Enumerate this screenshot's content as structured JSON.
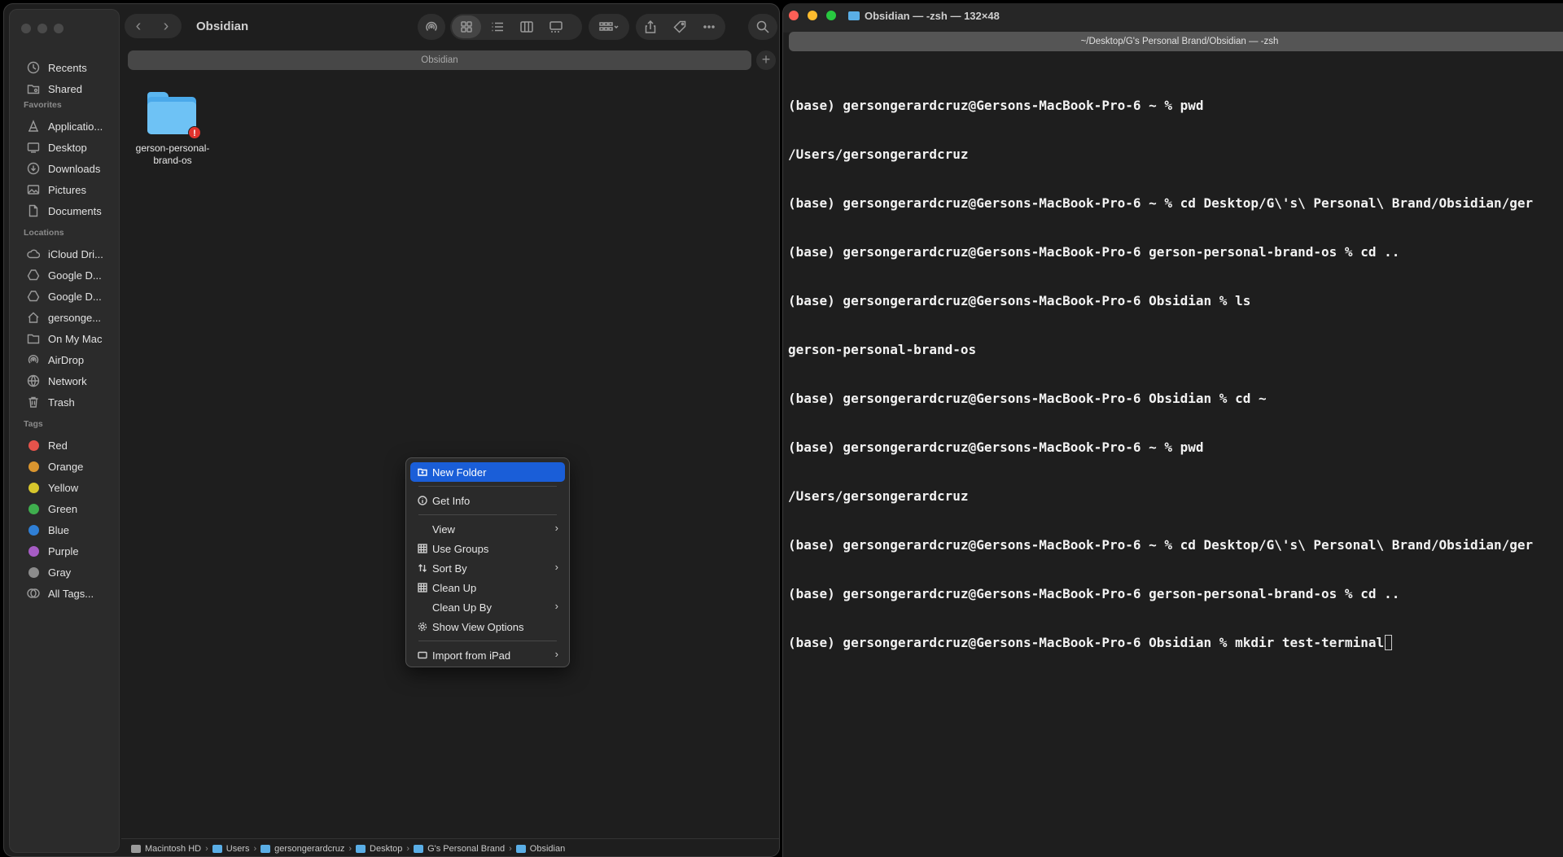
{
  "finder": {
    "window_title": "Obsidian",
    "tab_label": "Obsidian",
    "sidebar": {
      "top_items": [
        {
          "label": "Recents",
          "icon": "clock-icon"
        },
        {
          "label": "Shared",
          "icon": "shared-folder-icon"
        }
      ],
      "favorites_heading": "Favorites",
      "favorites": [
        {
          "label": "Applicatio...",
          "icon": "applications-icon"
        },
        {
          "label": "Desktop",
          "icon": "desktop-icon"
        },
        {
          "label": "Downloads",
          "icon": "download-icon"
        },
        {
          "label": "Pictures",
          "icon": "pictures-icon"
        },
        {
          "label": "Documents",
          "icon": "document-icon"
        }
      ],
      "locations_heading": "Locations",
      "locations": [
        {
          "label": "iCloud Dri...",
          "icon": "cloud-icon"
        },
        {
          "label": "Google D...",
          "icon": "drive-icon"
        },
        {
          "label": "Google D...",
          "icon": "drive-icon"
        },
        {
          "label": "gersonge...",
          "icon": "home-icon"
        },
        {
          "label": "On My Mac",
          "icon": "folder-icon"
        },
        {
          "label": "AirDrop",
          "icon": "airdrop-icon"
        },
        {
          "label": "Network",
          "icon": "globe-icon"
        },
        {
          "label": "Trash",
          "icon": "trash-icon"
        }
      ],
      "tags_heading": "Tags",
      "tags": [
        {
          "label": "Red",
          "color": "#e5534b"
        },
        {
          "label": "Orange",
          "color": "#d9952f"
        },
        {
          "label": "Yellow",
          "color": "#d7c62c"
        },
        {
          "label": "Green",
          "color": "#3fae4e"
        },
        {
          "label": "Blue",
          "color": "#2f7fd6"
        },
        {
          "label": "Purple",
          "color": "#a65cc4"
        },
        {
          "label": "Gray",
          "color": "#8c8c8c"
        }
      ],
      "all_tags": "All Tags..."
    },
    "files": [
      {
        "name_line1": "gerson-personal-",
        "name_line2": "brand-os",
        "badge": "!"
      }
    ],
    "path_bar": [
      "Macintosh HD",
      "Users",
      "gersongerardcruz",
      "Desktop",
      "G's Personal Brand",
      "Obsidian"
    ],
    "context_menu": {
      "new_folder": "New Folder",
      "get_info": "Get Info",
      "view": "View",
      "use_groups": "Use Groups",
      "sort_by": "Sort By",
      "clean_up": "Clean Up",
      "clean_up_by": "Clean Up By",
      "show_view_options": "Show View Options",
      "import_from_ipad": "Import from iPad"
    }
  },
  "terminal": {
    "title": "Obsidian — -zsh — 132×48",
    "tab_label": "~/Desktop/G's Personal Brand/Obsidian — -zsh",
    "lines": [
      "(base) gersongerardcruz@Gersons-MacBook-Pro-6 ~ % pwd",
      "/Users/gersongerardcruz",
      "(base) gersongerardcruz@Gersons-MacBook-Pro-6 ~ % cd Desktop/G\\'s\\ Personal\\ Brand/Obsidian/ger",
      "(base) gersongerardcruz@Gersons-MacBook-Pro-6 gerson-personal-brand-os % cd ..",
      "(base) gersongerardcruz@Gersons-MacBook-Pro-6 Obsidian % ls",
      "gerson-personal-brand-os",
      "(base) gersongerardcruz@Gersons-MacBook-Pro-6 Obsidian % cd ~",
      "(base) gersongerardcruz@Gersons-MacBook-Pro-6 ~ % pwd",
      "/Users/gersongerardcruz",
      "(base) gersongerardcruz@Gersons-MacBook-Pro-6 ~ % cd Desktop/G\\'s\\ Personal\\ Brand/Obsidian/ger",
      "(base) gersongerardcruz@Gersons-MacBook-Pro-6 gerson-personal-brand-os % cd ..",
      "(base) gersongerardcruz@Gersons-MacBook-Pro-6 Obsidian % mkdir test-terminal"
    ]
  }
}
